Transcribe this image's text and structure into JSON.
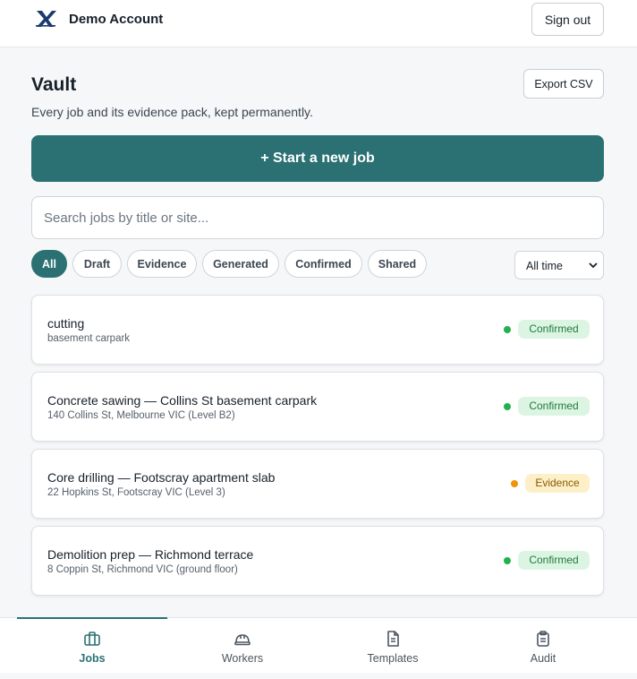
{
  "header": {
    "account_name": "Demo Account",
    "signout_label": "Sign out",
    "logo_icon": "brand-logo-icon"
  },
  "page": {
    "title": "Vault",
    "subtitle": "Every job and its evidence pack, kept permanently.",
    "export_label": "Export CSV"
  },
  "new_job_label": "+ Start a new job",
  "search": {
    "placeholder": "Search jobs by title or site...",
    "value": ""
  },
  "filters": [
    {
      "label": "All",
      "active": true
    },
    {
      "label": "Draft",
      "active": false
    },
    {
      "label": "Evidence",
      "active": false
    },
    {
      "label": "Generated",
      "active": false
    },
    {
      "label": "Confirmed",
      "active": false
    },
    {
      "label": "Shared",
      "active": false
    }
  ],
  "time_filter": {
    "selected": "All time"
  },
  "jobs": [
    {
      "title": "cutting",
      "site": "basement carpark",
      "status": "Confirmed"
    },
    {
      "title": "Concrete sawing — Collins St basement carpark",
      "site": "140 Collins St, Melbourne VIC (Level B2)",
      "status": "Confirmed"
    },
    {
      "title": "Core drilling — Footscray apartment slab",
      "site": "22 Hopkins St, Footscray VIC (Level 3)",
      "status": "Evidence"
    },
    {
      "title": "Demolition prep — Richmond terrace",
      "site": "8 Coppin St, Richmond VIC (ground floor)",
      "status": "Confirmed"
    }
  ],
  "nav": [
    {
      "label": "Jobs",
      "icon": "briefcase-icon",
      "active": true
    },
    {
      "label": "Workers",
      "icon": "hard-hat-icon",
      "active": false
    },
    {
      "label": "Templates",
      "icon": "document-icon",
      "active": false
    },
    {
      "label": "Audit",
      "icon": "clipboard-icon",
      "active": false
    }
  ],
  "colors": {
    "accent": "#2b7173",
    "confirmed_dot": "#22b14c",
    "evidence_dot": "#f0920c",
    "confirmed_badge": "#dcf5e3",
    "evidence_badge": "#fdf0c8"
  }
}
